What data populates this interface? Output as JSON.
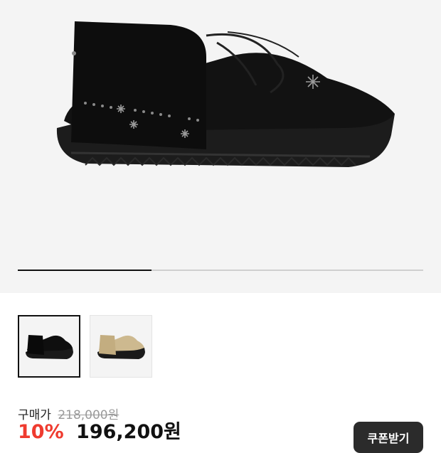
{
  "gallery": {
    "main_image": "black-suede-moccasin-shoe",
    "progress": 0.33,
    "thumbnails": [
      {
        "name": "black-shoe-thumbnail",
        "color": "#111111",
        "selected": true
      },
      {
        "name": "beige-shoe-thumbnail",
        "color": "#cdb98f",
        "selected": false
      }
    ]
  },
  "price": {
    "label": "구매가",
    "original": "218,000원",
    "discount": "10%",
    "final": "196,200원"
  },
  "coupon_button": {
    "label": "쿠폰받기"
  },
  "colors": {
    "accent_red": "#ef3b2f",
    "button_dark": "#2b2b2b"
  }
}
